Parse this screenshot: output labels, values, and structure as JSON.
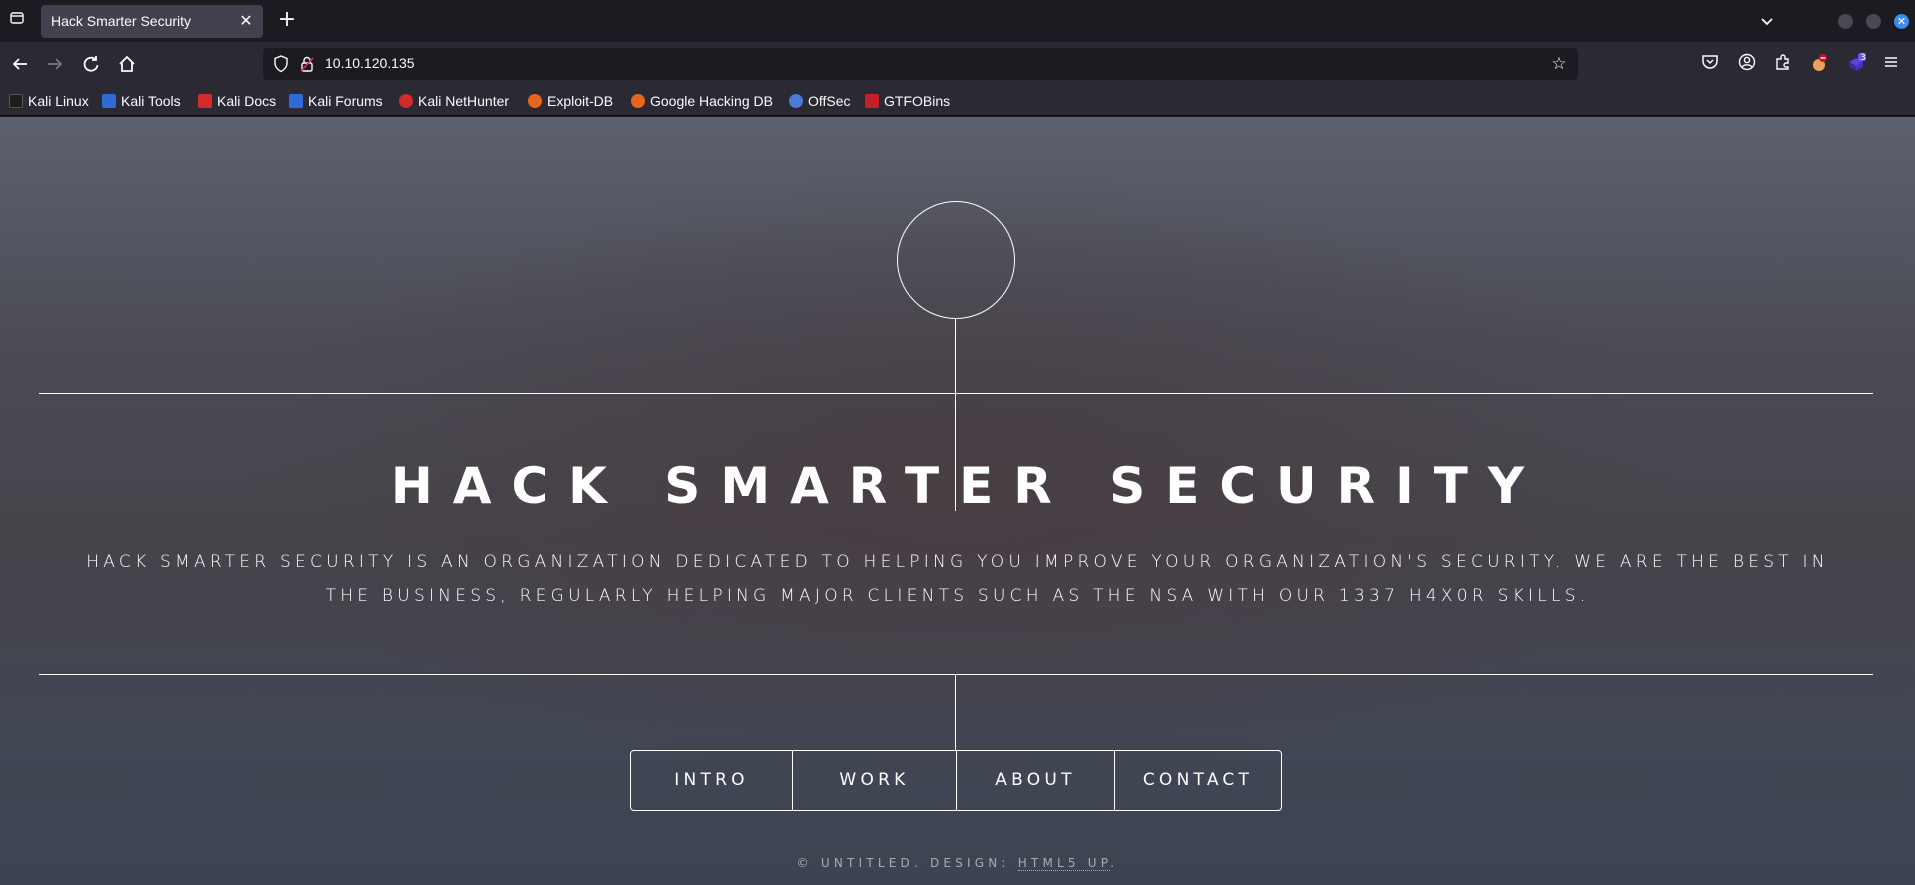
{
  "browser": {
    "tab": {
      "title": "Hack Smarter Security",
      "close": "✕"
    },
    "new_tab": "+",
    "url": "10.10.120.135",
    "extension_badge": "3"
  },
  "bookmarks": [
    {
      "label": "Kali Linux",
      "icon": "kali-dragon-icon",
      "color": "#1d1d1d"
    },
    {
      "label": "Kali Tools",
      "icon": "kali-tools-icon",
      "color": "#2f6bd8"
    },
    {
      "label": "Kali Docs",
      "icon": "kali-docs-icon",
      "color": "#d42a2a"
    },
    {
      "label": "Kali Forums",
      "icon": "kali-forums-icon",
      "color": "#2f6bd8"
    },
    {
      "label": "Kali NetHunter",
      "icon": "nethunter-icon",
      "color": "#d42a2a"
    },
    {
      "label": "Exploit-DB",
      "icon": "exploit-db-icon",
      "color": "#e8661c"
    },
    {
      "label": "Google Hacking DB",
      "icon": "ghdb-icon",
      "color": "#e8661c"
    },
    {
      "label": "OffSec",
      "icon": "offsec-icon",
      "color": "#4a7bd8"
    },
    {
      "label": "GTFOBins",
      "icon": "gtfobins-icon",
      "color": "#c4202a"
    }
  ],
  "page": {
    "title": "HACK SMARTER SECURITY",
    "description": "Hack Smarter Security is an organization dedicated to helping you improve your organization's security. We are the best in the business, regularly helping major clients such as the NSA with our 1337 H4X0R skills.",
    "nav": [
      "INTRO",
      "WORK",
      "ABOUT",
      "CONTACT"
    ],
    "footer_prefix": "© UNTITLED. DESIGN: ",
    "footer_credit": "HTML5 UP",
    "footer_suffix": "."
  },
  "colors": {
    "accent": "#ffffff",
    "chrome_bg": "#1c1b22",
    "toolbar_bg": "#2b2a33"
  }
}
